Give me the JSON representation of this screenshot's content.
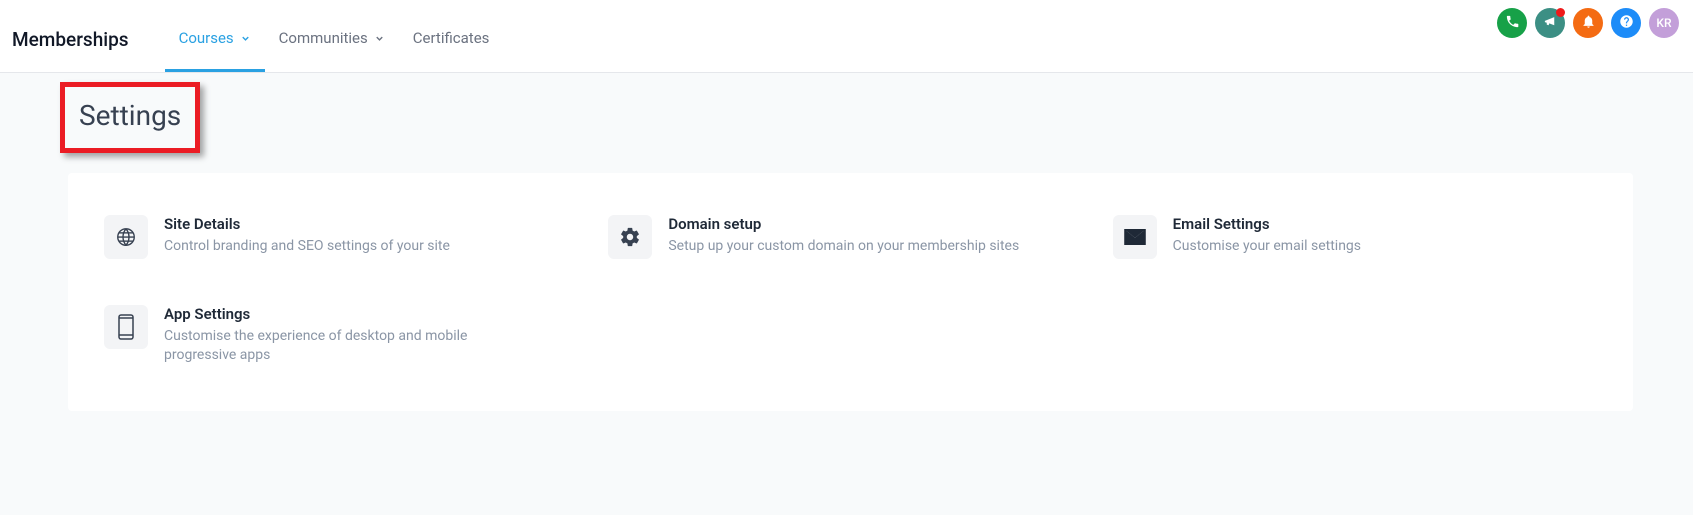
{
  "header": {
    "section_label": "Memberships",
    "tabs": [
      {
        "label": "Courses",
        "active": true,
        "hasDropdown": true
      },
      {
        "label": "Communities",
        "active": false,
        "hasDropdown": true
      },
      {
        "label": "Certificates",
        "active": false,
        "hasDropdown": false
      }
    ],
    "avatar_initials": "KR"
  },
  "page": {
    "title": "Settings"
  },
  "settings": [
    {
      "icon": "globe-icon",
      "title": "Site Details",
      "desc": "Control branding and SEO settings of your site"
    },
    {
      "icon": "gear-icon",
      "title": "Domain setup",
      "desc": "Setup up your custom domain on your membership sites"
    },
    {
      "icon": "mail-icon",
      "title": "Email Settings",
      "desc": "Customise your email settings"
    },
    {
      "icon": "mobile-icon",
      "title": "App Settings",
      "desc": "Customise the experience of desktop and mobile progressive apps"
    }
  ]
}
